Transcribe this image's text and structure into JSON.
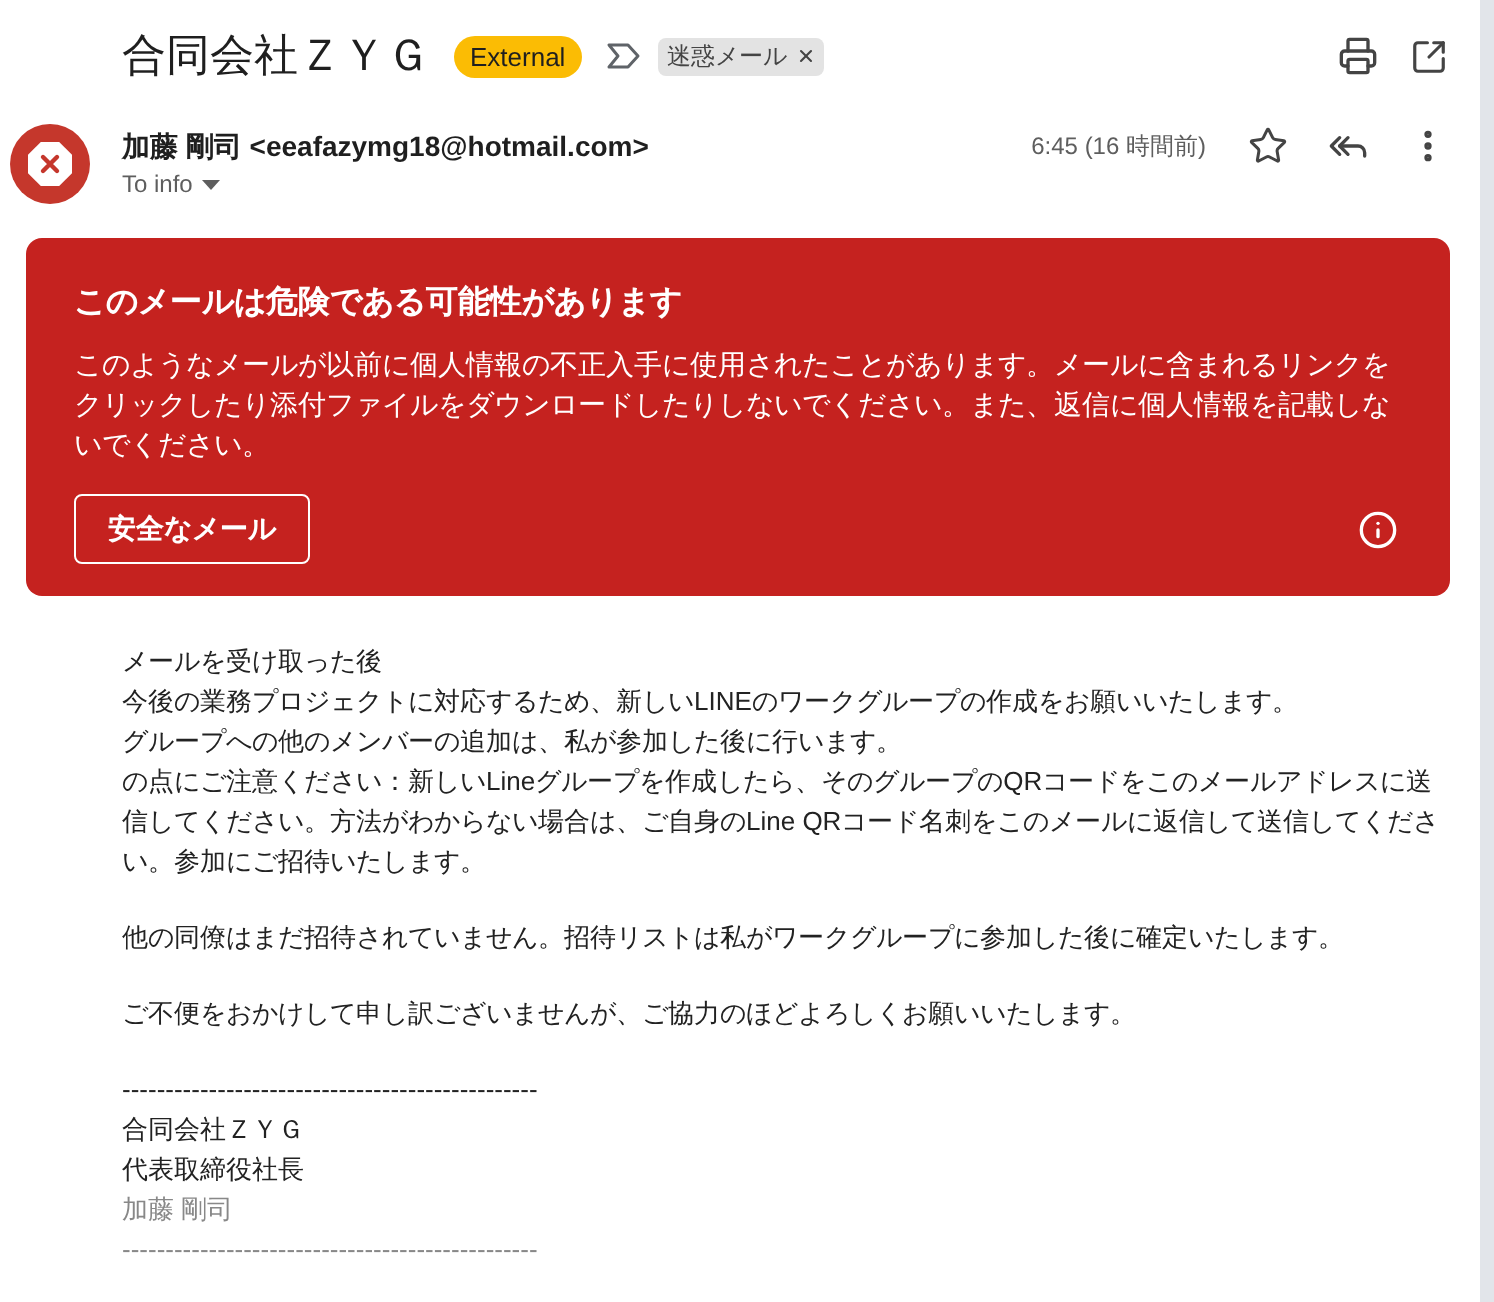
{
  "header": {
    "subject": "合同会社ＺＹＧ",
    "badge": "External",
    "labels": [
      {
        "text": "迷惑メール"
      }
    ]
  },
  "sender": {
    "from": "加藤 剛司 <eeafazymg18@hotmail.com>",
    "recipient": "To info",
    "time": "6:45 (16 時間前)",
    "starred": false
  },
  "warning": {
    "title": "このメールは危険である可能性があります",
    "message": "このようなメールが以前に個人情報の不正入手に使用されたことがあります。メールに含まれるリンクをクリックしたり添付ファイルをダウンロードしたりしないでください。また、返信に個人情報を記載しないでください。",
    "button": "安全なメール"
  },
  "body": {
    "paragraphs": [
      [
        "メールを受け取った後",
        "今後の業務プロジェクトに対応するため、新しいLINEのワークグループの作成をお願いいたします。",
        "グループへの他のメンバーの追加は、私が参加した後に行います。",
        "の点にご注意ください：新しいLineグループを作成したら、そのグループのQRコードをこのメールアドレスに送信してください。方法がわからない場合は、ご自身のLine QRコード名刺をこのメールに返信して送信してください。参加にご招待いたします。"
      ],
      [
        "他の同僚はまだ招待されていません。招待リストは私がワークグループに参加した後に確定いたします。"
      ],
      [
        "ご不便をおかけして申し訳ございませんが、ご協力のほどよろしくお願いいたします。"
      ]
    ],
    "signature": [
      {
        "text": "------------------------------------------------",
        "muted": false
      },
      {
        "text": "合同会社ＺＹＧ",
        "muted": false
      },
      {
        "text": "代表取締役社長",
        "muted": false
      },
      {
        "text": "加藤 剛司",
        "muted": true
      },
      {
        "text": "------------------------------------------------",
        "muted": true
      }
    ]
  }
}
